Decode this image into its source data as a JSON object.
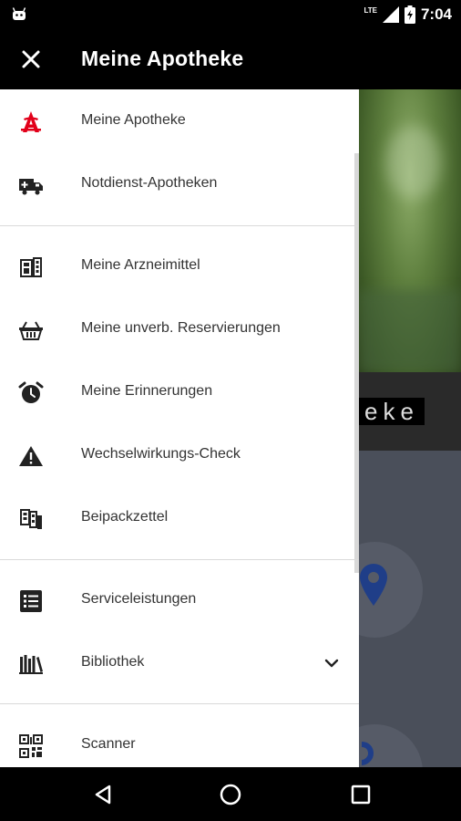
{
  "status_bar": {
    "network": "LTE",
    "time": "7:04",
    "icons": [
      "android-icon",
      "signal-icon",
      "battery-icon"
    ]
  },
  "app_bar": {
    "title": "Meine Apotheke",
    "close_icon": "close-icon"
  },
  "drawer": {
    "items": [
      {
        "label": "Meine Apotheke",
        "icon": "pharmacy-a-icon"
      },
      {
        "label": "Notdienst-Apotheken",
        "icon": "ambulance-icon"
      },
      {
        "label": "Meine Arzneimittel",
        "icon": "medicine-pack-icon"
      },
      {
        "label": "Meine unverb. Reservierungen",
        "icon": "basket-icon"
      },
      {
        "label": "Meine Erinnerungen",
        "icon": "alarm-clock-icon"
      },
      {
        "label": "Wechselwirkungs-Check",
        "icon": "warning-icon"
      },
      {
        "label": "Beipackzettel",
        "icon": "leaflet-icon"
      },
      {
        "label": "Serviceleistungen",
        "icon": "list-icon"
      },
      {
        "label": "Bibliothek",
        "icon": "library-icon"
      },
      {
        "label": "Scanner",
        "icon": "qr-code-icon"
      }
    ]
  },
  "background": {
    "partial_word": "eke"
  },
  "colors": {
    "accent": "#e2001a",
    "bar": "#000000",
    "drawer_bg": "#ffffff",
    "text": "#333333"
  },
  "nav_bar": {
    "icons": [
      "back-icon",
      "home-icon",
      "recents-icon"
    ]
  }
}
